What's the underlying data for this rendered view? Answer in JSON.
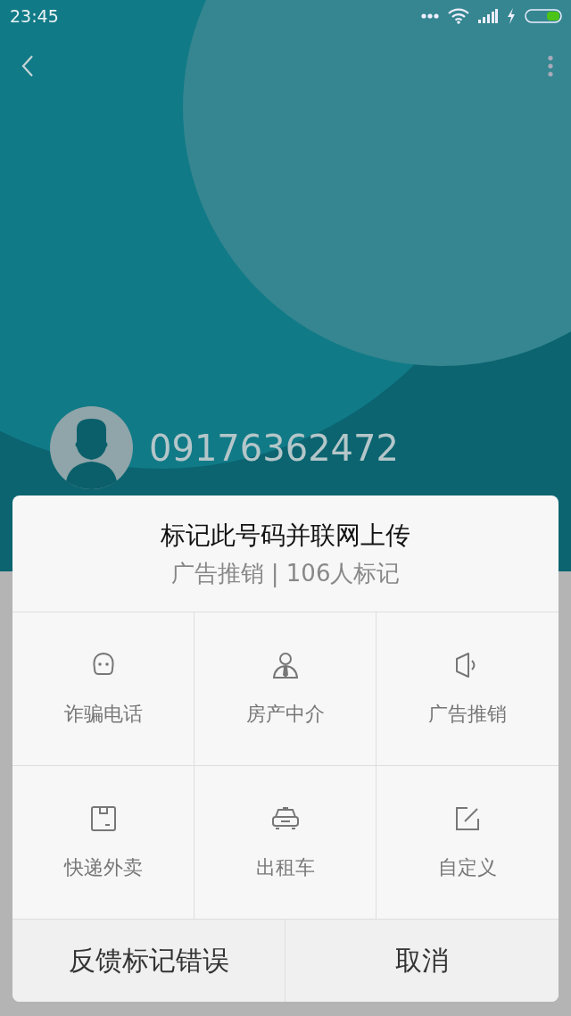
{
  "status_bar": {
    "time": "23:45"
  },
  "contact": {
    "number": "09176362472"
  },
  "dialog": {
    "title": "标记此号码并联网上传",
    "subtitle": "广告推销 | 106人标记",
    "categories": [
      {
        "label": "诈骗电话",
        "kind": "fraud"
      },
      {
        "label": "房产中介",
        "kind": "agent"
      },
      {
        "label": "广告推销",
        "kind": "ad"
      },
      {
        "label": "快递外卖",
        "kind": "delivery"
      },
      {
        "label": "出租车",
        "kind": "taxi"
      },
      {
        "label": "自定义",
        "kind": "custom"
      }
    ],
    "buttons": [
      {
        "label": "反馈标记错误"
      },
      {
        "label": "取消"
      }
    ]
  }
}
